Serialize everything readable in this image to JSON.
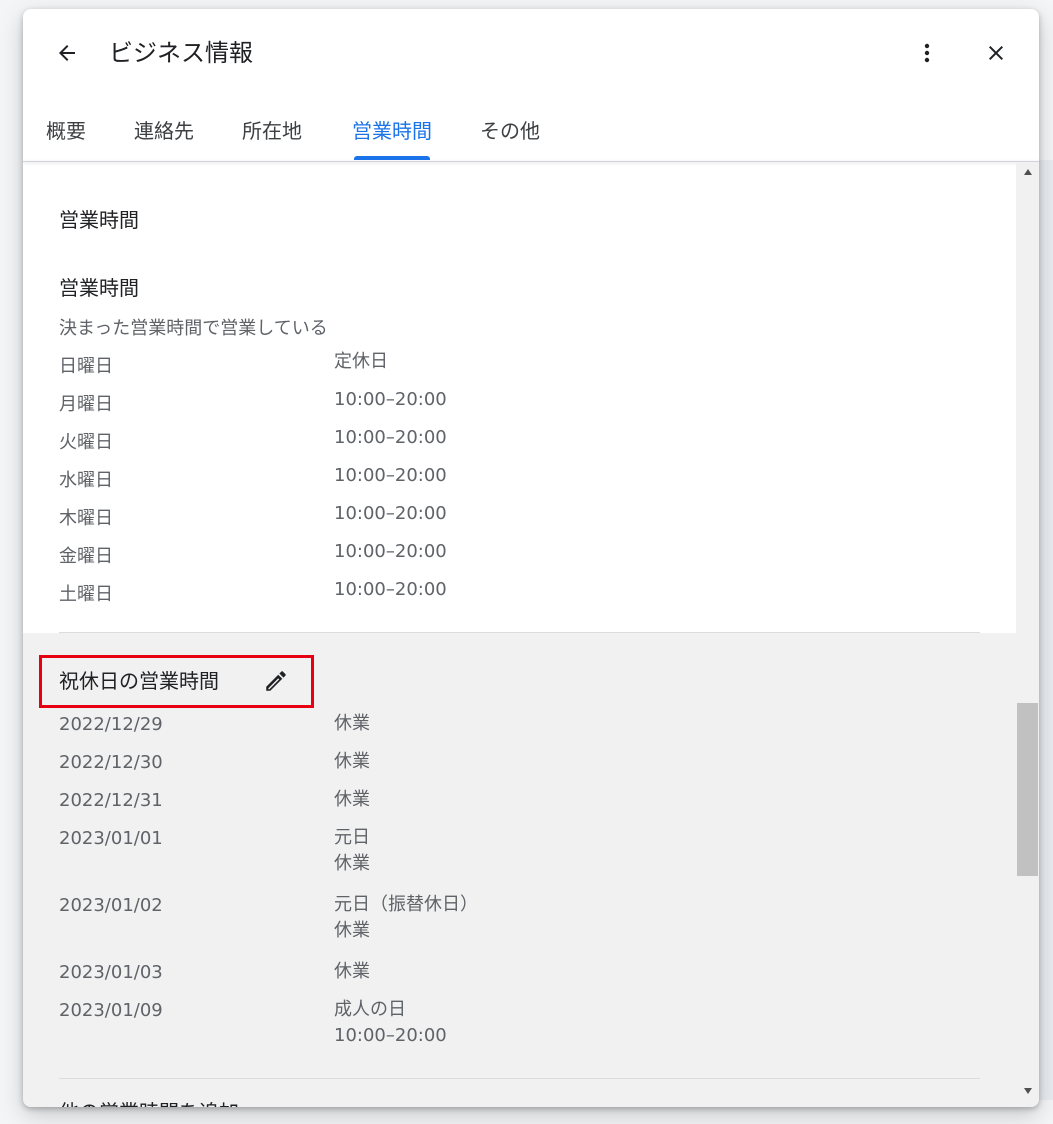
{
  "header": {
    "title": "ビジネス情報",
    "back_icon": "arrow-back-icon",
    "more_icon": "more-vert-icon",
    "close_icon": "close-icon"
  },
  "tabs": [
    {
      "label": "概要",
      "active": false
    },
    {
      "label": "連絡先",
      "active": false
    },
    {
      "label": "所在地",
      "active": false
    },
    {
      "label": "営業時間",
      "active": true
    },
    {
      "label": "その他",
      "active": false
    }
  ],
  "hours": {
    "section_title": "営業時間",
    "sub_title": "営業時間",
    "description": "決まった営業時間で営業している",
    "days": [
      {
        "day": "日曜日",
        "value": "定休日"
      },
      {
        "day": "月曜日",
        "value": "10:00–20:00"
      },
      {
        "day": "火曜日",
        "value": "10:00–20:00"
      },
      {
        "day": "水曜日",
        "value": "10:00–20:00"
      },
      {
        "day": "木曜日",
        "value": "10:00–20:00"
      },
      {
        "day": "金曜日",
        "value": "10:00–20:00"
      },
      {
        "day": "土曜日",
        "value": "10:00–20:00"
      }
    ]
  },
  "holiday": {
    "title": "祝休日の営業時間",
    "edit_icon": "pencil-edit-icon",
    "highlight_color": "#e60012",
    "entries": [
      {
        "date": "2022/12/29",
        "line1": "休業",
        "line2": ""
      },
      {
        "date": "2022/12/30",
        "line1": "休業",
        "line2": ""
      },
      {
        "date": "2022/12/31",
        "line1": "休業",
        "line2": ""
      },
      {
        "date": "2023/01/01",
        "line1": "元日",
        "line2": "休業"
      },
      {
        "date": "2023/01/02",
        "line1": "元日（振替休日）",
        "line2": "休業"
      },
      {
        "date": "2023/01/03",
        "line1": "休業",
        "line2": ""
      },
      {
        "date": "2023/01/09",
        "line1": "成人の日",
        "line2": "10:00–20:00"
      }
    ]
  },
  "more_section": {
    "title": "他の営業時間を追加"
  },
  "colors": {
    "accent": "#1a73e8"
  }
}
